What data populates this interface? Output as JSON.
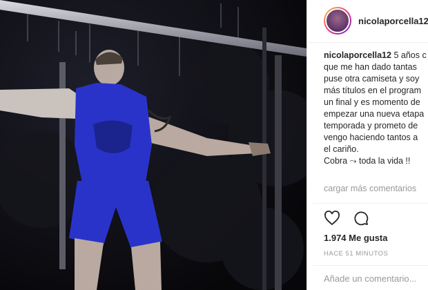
{
  "post": {
    "username": "nicolaporcella12",
    "caption_user": "nicolaporcella12",
    "caption_lines": [
      "5 años c",
      "que me han dado tantas",
      "puse otra camiseta y soy",
      "más títulos en el program",
      "un final y es momento de",
      "empezar una nueva etapa",
      "temporada y prometo de",
      "vengo haciendo tantos a",
      "el cariño.",
      "Cobra ⤳ toda la vida !!"
    ],
    "load_more_comments": "cargar más comentarios",
    "likes": "1.974 Me gusta",
    "time_ago": "HACE 51 MINUTOS",
    "comment_placeholder": "Añade un comentario..."
  },
  "icons": {
    "like": "heart-icon",
    "comment": "comment-bubble-icon"
  },
  "colors": {
    "text": "#262626",
    "muted": "#999999",
    "jersey": "#2a33c9",
    "background": "#0b0b10"
  }
}
